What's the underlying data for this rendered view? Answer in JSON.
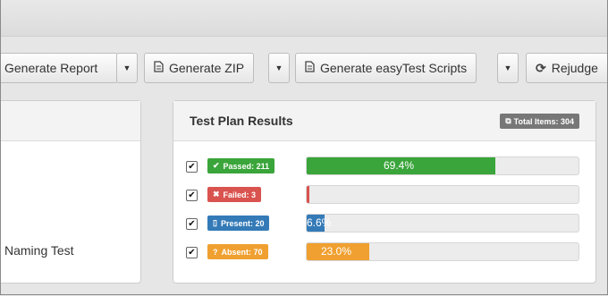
{
  "colors": {
    "passed": "#3aa53a",
    "failed": "#d9534f",
    "present": "#337ab7",
    "absent": "#f0a030",
    "badge": "#777777"
  },
  "toolbar": {
    "generate_report": "Generate Report",
    "generate_zip": "Generate ZIP",
    "generate_scripts": "Generate easyTest Scripts",
    "rejudge": "Rejudge"
  },
  "left_panel": {
    "item_text": "Naming Test"
  },
  "results": {
    "title": "Test Plan Results",
    "total_label": "Total Items: 304",
    "rows": [
      {
        "key": "passed",
        "icon": "check-icon",
        "label": "Passed: 211",
        "percent_text": "69.4%",
        "percent": 69.4,
        "color": "#3aa53a"
      },
      {
        "key": "failed",
        "icon": "x-icon",
        "label": "Failed: 3",
        "percent_text": "",
        "percent": 1.0,
        "color": "#d9534f"
      },
      {
        "key": "present",
        "icon": "document-icon",
        "label": "Present: 20",
        "percent_text": "6.6%",
        "percent": 6.6,
        "color": "#337ab7"
      },
      {
        "key": "absent",
        "icon": "question-icon",
        "label": "Absent: 70",
        "percent_text": "23.0%",
        "percent": 23.0,
        "color": "#f0a030"
      }
    ]
  }
}
